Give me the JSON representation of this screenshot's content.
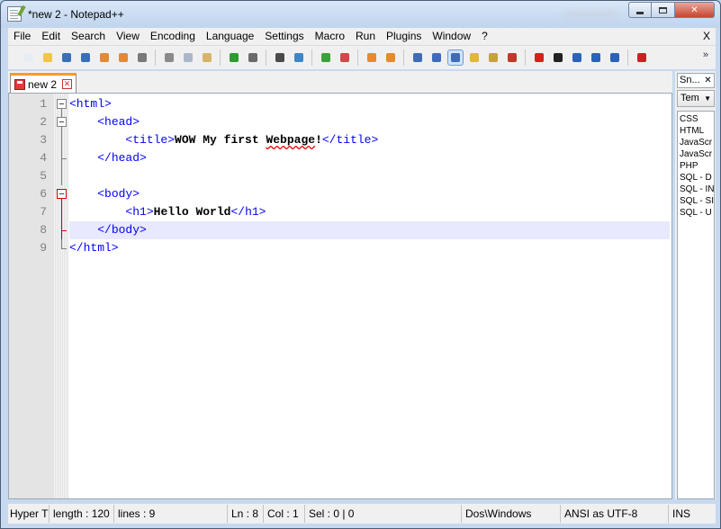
{
  "window": {
    "title": "*new  2 - Notepad++"
  },
  "menu": {
    "items": [
      "File",
      "Edit",
      "Search",
      "View",
      "Encoding",
      "Language",
      "Settings",
      "Macro",
      "Run",
      "Plugins",
      "Window",
      "?"
    ],
    "close_label": "X"
  },
  "toolbar": {
    "buttons": [
      {
        "icon": "new-file-icon",
        "color": "#e8edf5"
      },
      {
        "icon": "open-file-icon",
        "color": "#f3c44b"
      },
      {
        "icon": "save-icon",
        "color": "#3b6fb6"
      },
      {
        "icon": "save-all-icon",
        "color": "#3b6fb6"
      },
      {
        "icon": "close-file-icon",
        "color": "#e08a3a"
      },
      {
        "icon": "close-all-icon",
        "color": "#e08a3a"
      },
      {
        "icon": "print-icon",
        "color": "#7a7a7a"
      },
      {
        "sep": true
      },
      {
        "icon": "cut-icon",
        "color": "#8a8a8a"
      },
      {
        "icon": "copy-icon",
        "color": "#a9b7c9"
      },
      {
        "icon": "paste-icon",
        "color": "#d8b36a"
      },
      {
        "sep": true
      },
      {
        "icon": "undo-icon",
        "color": "#2f9a2f"
      },
      {
        "icon": "redo-icon",
        "color": "#6a6a6a"
      },
      {
        "sep": true
      },
      {
        "icon": "find-icon",
        "color": "#4a4a4a"
      },
      {
        "icon": "replace-icon",
        "color": "#3d86c6"
      },
      {
        "sep": true
      },
      {
        "icon": "zoom-in-icon",
        "color": "#3aa23a"
      },
      {
        "icon": "zoom-out-icon",
        "color": "#d04848"
      },
      {
        "sep": true
      },
      {
        "icon": "sync-vertical-icon",
        "color": "#e58b2a"
      },
      {
        "icon": "sync-horizontal-icon",
        "color": "#e58b2a"
      },
      {
        "sep": true
      },
      {
        "icon": "word-wrap-icon",
        "color": "#3f6cb5"
      },
      {
        "icon": "show-all-chars-icon",
        "color": "#3f6cb5"
      },
      {
        "icon": "indent-guide-icon",
        "color": "#3f6cb5",
        "active": true
      },
      {
        "icon": "doc-map-icon",
        "color": "#e2b53c"
      },
      {
        "icon": "function-list-icon",
        "color": "#c7a23a"
      },
      {
        "icon": "folder-workspace-icon",
        "color": "#c0392b"
      },
      {
        "sep": true
      },
      {
        "icon": "record-macro-icon",
        "color": "#d91e1e"
      },
      {
        "icon": "stop-record-icon",
        "color": "#222222"
      },
      {
        "icon": "play-macro-icon",
        "color": "#2a63b8"
      },
      {
        "icon": "run-macro-multiple-icon",
        "color": "#2a63b8"
      },
      {
        "icon": "save-macro-icon",
        "color": "#2a63b8"
      },
      {
        "sep": true
      },
      {
        "icon": "spell-check-icon",
        "color": "#c82323"
      }
    ],
    "more_label": "»"
  },
  "tabs": [
    {
      "label": "new  2",
      "close": "✕"
    }
  ],
  "editor": {
    "lines": [
      {
        "num": "1",
        "fold": "open",
        "indent": "",
        "parts": [
          {
            "t": "tag",
            "v": "<html>"
          }
        ]
      },
      {
        "num": "2",
        "fold": "open-nested",
        "indent": "    ",
        "parts": [
          {
            "t": "tag",
            "v": "<head>"
          }
        ]
      },
      {
        "num": "3",
        "fold": "line",
        "indent": "        ",
        "parts": [
          {
            "t": "tag",
            "v": "<title>"
          },
          {
            "t": "txt",
            "v": "WOW My first "
          },
          {
            "t": "spell",
            "v": "Webpage"
          },
          {
            "t": "txt",
            "v": "!"
          },
          {
            "t": "tag",
            "v": "</title>"
          }
        ]
      },
      {
        "num": "4",
        "fold": "end-nested",
        "indent": "    ",
        "parts": [
          {
            "t": "tag",
            "v": "</head>"
          }
        ]
      },
      {
        "num": "5",
        "fold": "line",
        "indent": "",
        "parts": []
      },
      {
        "num": "6",
        "fold": "open-red",
        "indent": "    ",
        "parts": [
          {
            "t": "tag",
            "v": "<body>"
          }
        ]
      },
      {
        "num": "7",
        "fold": "line-red",
        "indent": "        ",
        "parts": [
          {
            "t": "tag",
            "v": "<h1>"
          },
          {
            "t": "txt",
            "v": "Hello World"
          },
          {
            "t": "tag",
            "v": "</h1>"
          }
        ]
      },
      {
        "num": "8",
        "fold": "end-red",
        "indent": "    ",
        "current": true,
        "parts": [
          {
            "t": "tag",
            "v": "</body>"
          }
        ]
      },
      {
        "num": "9",
        "fold": "end",
        "indent": "",
        "parts": [
          {
            "t": "tag",
            "v": "</html>"
          }
        ]
      }
    ]
  },
  "side_panel": {
    "title": "Sn...",
    "close": "✕",
    "select_value": "Tem",
    "items": [
      "CSS",
      "HTML",
      "JavaScr",
      "JavaScr",
      "PHP",
      "SQL - D",
      "SQL - IN",
      "SQL - SI",
      "SQL - U"
    ]
  },
  "status": {
    "lang": "Hyper T",
    "length": "length : 120",
    "lines": "lines : 9",
    "ln": "Ln : 8",
    "col": "Col : 1",
    "sel": "Sel : 0 | 0",
    "eol": "Dos\\Windows",
    "encoding": "ANSI as UTF-8",
    "mode": "INS"
  },
  "colors": {
    "tag": "#0000ff",
    "text": "#000000",
    "current_line": "#e8e8ff",
    "tab_accent": "#fa9a2a"
  }
}
